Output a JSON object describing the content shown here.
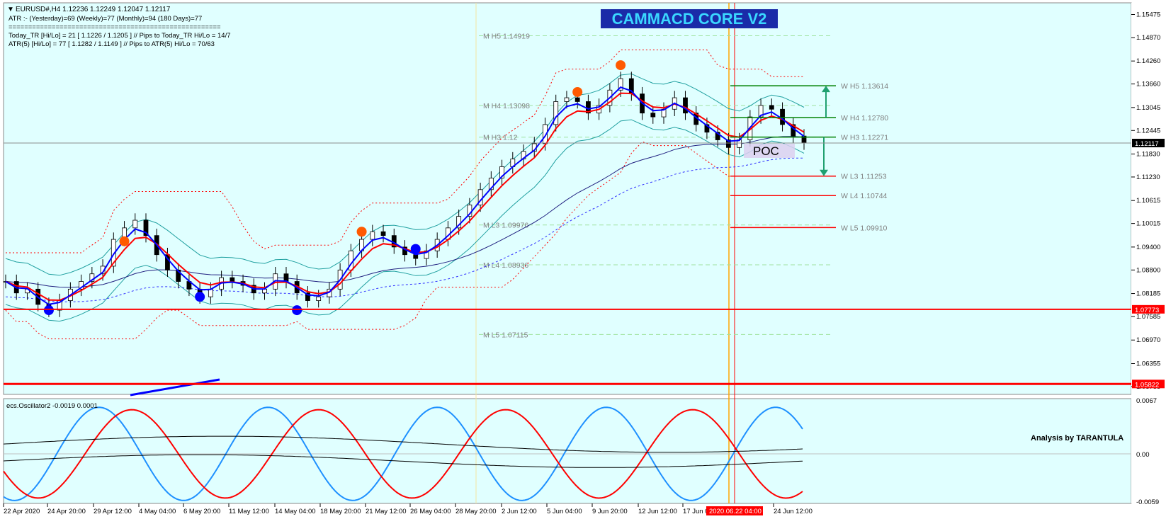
{
  "chart_title_banner": "CAMMACD CORE V2",
  "symbol_header": {
    "arrow_icon": "triangle-down-icon",
    "text": "EURUSD#,H4  1.12236 1.12249 1.12047 1.12117"
  },
  "info_lines": [
    "ATR :- (Yesterday)=69       (Weekly)=77       (Monthly)=94       (180 Days)=77",
    "======================================================",
    "Today_TR [Hi/Lo] = 21 [ 1.1226 / 1.1205 ]   // Pips to Today_TR Hi/Lo  = 14/7",
    "ATR(5)       [Hi/Lo] = 77 [ 1.1282 / 1.1149 ]  //  Pips to ATR(5) Hi/Lo      = 70/63"
  ],
  "monthly_levels": [
    {
      "label": "M  H5 1.14919",
      "value": 1.14919
    },
    {
      "label": "M  H4 1.13098",
      "value": 1.13098
    },
    {
      "label": "M  H3 1.12",
      "value": 1.1227
    },
    {
      "label": "M  L3 1.09976",
      "value": 1.09976
    },
    {
      "label": "M  L4 1.08936",
      "value": 1.08936
    },
    {
      "label": "M  L5 1.07115",
      "value": 1.07115
    }
  ],
  "weekly_levels": [
    {
      "label": "W  H5 1.13614",
      "value": 1.13614,
      "color": "#008000"
    },
    {
      "label": "W  H4 1.12780",
      "value": 1.1278,
      "color": "#008000"
    },
    {
      "label": "W  H3 1.12271",
      "value": 1.12271,
      "color": "#008000"
    },
    {
      "label": "W  L3 1.11253",
      "value": 1.11253,
      "color": "#ff0000"
    },
    {
      "label": "W  L4 1.10744",
      "value": 1.10744,
      "color": "#ff0000"
    },
    {
      "label": "W  L5 1.09910",
      "value": 1.0991,
      "color": "#ff0000"
    }
  ],
  "poc_label": "POC",
  "price_axis_ticks": [
    "1.15475",
    "1.14870",
    "1.14260",
    "1.13660",
    "1.13045",
    "1.12445",
    "1.11830",
    "1.11230",
    "1.10615",
    "1.10015",
    "1.09400",
    "1.08800",
    "1.08185",
    "1.07585",
    "1.06970",
    "1.06355",
    "1.05755"
  ],
  "price_labels": [
    {
      "text": "1.12117",
      "value": 1.12117,
      "bg": "#000000"
    },
    {
      "text": "1.07773",
      "value": 1.07773,
      "bg": "#ff0000"
    },
    {
      "text": "1.05822",
      "value": 1.05822,
      "bg": "#ff0000"
    }
  ],
  "osc_header": "ecs.Oscillator2 -0.0019 0.0001",
  "osc_axis_ticks": [
    "0.0067",
    "0.00",
    "-0.0059"
  ],
  "osc_note": "Analysis by TARANTULA",
  "time_axis_labels": [
    "22 Apr 2020",
    "24 Apr 20:00",
    "29 Apr 12:00",
    "4 May 04:00",
    "6 May 20:00",
    "11 May 12:00",
    "14 May 04:00",
    "18 May 20:00",
    "21 May 12:00",
    "26 May 04:00",
    "28 May 20:00",
    "2 Jun 12:00",
    "5 Jun 04:00",
    "9 Jun 20:00",
    "12 Jun 12:00",
    "17 Jun 0",
    "24 Jun 12:00"
  ],
  "time_highlight": "2020.06.22 04:00",
  "colors": {
    "background": "#e0ffff",
    "fast_ma": "#0000ff",
    "slow_ma": "#ff0000",
    "bollinger": "#20a0a0",
    "red_line": "#ff0000",
    "orange_vline": "#ffa500",
    "green_arrow": "#20a070"
  },
  "chart_data": {
    "type": "line",
    "title": "CAMMACD CORE V2",
    "ylim": [
      1.0555,
      1.1578
    ],
    "last_price": 1.12117,
    "close_series_approx": [
      [
        0,
        1.085
      ],
      [
        1,
        1.082
      ],
      [
        2,
        1.083
      ],
      [
        3,
        1.079
      ],
      [
        4,
        1.0775
      ],
      [
        5,
        1.08
      ],
      [
        6,
        1.083
      ],
      [
        7,
        1.085
      ],
      [
        8,
        1.087
      ],
      [
        9,
        1.089
      ],
      [
        10,
        1.096
      ],
      [
        11,
        1.099
      ],
      [
        12,
        1.101
      ],
      [
        13,
        1.097
      ],
      [
        14,
        1.092
      ],
      [
        15,
        1.088
      ],
      [
        16,
        1.085
      ],
      [
        17,
        1.083
      ],
      [
        18,
        1.081
      ],
      [
        19,
        1.083
      ],
      [
        20,
        1.086
      ],
      [
        21,
        1.085
      ],
      [
        22,
        1.084
      ],
      [
        23,
        1.082
      ],
      [
        24,
        1.083
      ],
      [
        25,
        1.087
      ],
      [
        26,
        1.085
      ],
      [
        27,
        1.082
      ],
      [
        28,
        1.08
      ],
      [
        29,
        1.081
      ],
      [
        30,
        1.083
      ],
      [
        31,
        1.088
      ],
      [
        32,
        1.093
      ],
      [
        33,
        1.096
      ],
      [
        34,
        1.098
      ],
      [
        35,
        1.097
      ],
      [
        36,
        1.094
      ],
      [
        37,
        1.092
      ],
      [
        38,
        1.091
      ],
      [
        39,
        1.093
      ],
      [
        40,
        1.096
      ],
      [
        41,
        1.099
      ],
      [
        42,
        1.102
      ],
      [
        43,
        1.105
      ],
      [
        44,
        1.109
      ],
      [
        45,
        1.112
      ],
      [
        46,
        1.115
      ],
      [
        47,
        1.117
      ],
      [
        48,
        1.119
      ],
      [
        49,
        1.121
      ],
      [
        50,
        1.126
      ],
      [
        51,
        1.132
      ],
      [
        52,
        1.133
      ],
      [
        53,
        1.132
      ],
      [
        54,
        1.129
      ],
      [
        55,
        1.131
      ],
      [
        56,
        1.135
      ],
      [
        57,
        1.138
      ],
      [
        58,
        1.134
      ],
      [
        59,
        1.129
      ],
      [
        60,
        1.128
      ],
      [
        61,
        1.13
      ],
      [
        62,
        1.133
      ],
      [
        63,
        1.129
      ],
      [
        64,
        1.126
      ],
      [
        65,
        1.124
      ],
      [
        66,
        1.122
      ],
      [
        67,
        1.12
      ],
      [
        68,
        1.122
      ],
      [
        69,
        1.128
      ],
      [
        70,
        1.131
      ],
      [
        71,
        1.13
      ],
      [
        72,
        1.126
      ],
      [
        73,
        1.123
      ],
      [
        74,
        1.1212
      ]
    ],
    "osc_ylim": [
      -0.0059,
      0.0067
    ]
  }
}
